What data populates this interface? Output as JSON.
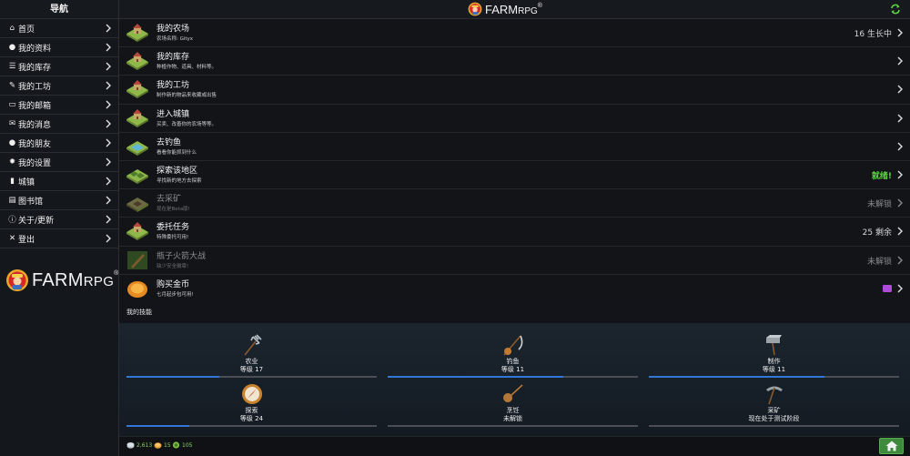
{
  "sidebar": {
    "title": "导航",
    "items": [
      {
        "label": "首页",
        "icon": "home-icon"
      },
      {
        "label": "我的资料",
        "icon": "user-icon"
      },
      {
        "label": "我的库存",
        "icon": "list-icon"
      },
      {
        "label": "我的工坊",
        "icon": "wrench-icon"
      },
      {
        "label": "我的邮箱",
        "icon": "inbox-icon"
      },
      {
        "label": "我的消息",
        "icon": "envelope-icon"
      },
      {
        "label": "我的朋友",
        "icon": "users-icon"
      },
      {
        "label": "我的设置",
        "icon": "gear-icon"
      },
      {
        "label": "城镇",
        "icon": "building-icon"
      },
      {
        "label": "图书馆",
        "icon": "book-icon"
      },
      {
        "label": "关于/更新",
        "icon": "info-icon"
      },
      {
        "label": "登出",
        "icon": "close-icon"
      }
    ],
    "logo": {
      "farm": "FARM",
      "rpg": "RPG",
      "tm": "®"
    }
  },
  "topbar": {
    "farm": "FARM",
    "rpg": "RPG",
    "tm": "®"
  },
  "menu": [
    {
      "title": "我的农场",
      "sub": "农场名称: Gityx",
      "right": "16 生长中",
      "state": "normal",
      "icon": "farm-icon"
    },
    {
      "title": "我的库存",
      "sub": "种植作物、道具、材料等。",
      "right": "",
      "state": "normal",
      "icon": "inventory-icon"
    },
    {
      "title": "我的工坊",
      "sub": "制作新的物品来收藏或出售",
      "right": "",
      "state": "normal",
      "icon": "workshop-icon"
    },
    {
      "title": "进入城镇",
      "sub": "买卖、改善你的农场等等。",
      "right": "",
      "state": "normal",
      "icon": "town-icon"
    },
    {
      "title": "去钓鱼",
      "sub": "看看你能抓到什么",
      "right": "",
      "state": "normal",
      "icon": "fishing-icon"
    },
    {
      "title": "探索该地区",
      "sub": "寻找新的地方去探索",
      "right": "就绪!",
      "state": "ready",
      "icon": "explore-icon"
    },
    {
      "title": "去采矿",
      "sub": "现在是Beta版!",
      "right": "未解锁",
      "state": "locked",
      "icon": "mining-icon"
    },
    {
      "title": "委托任务",
      "sub": "特殊委托可用!",
      "right": "25 剩余",
      "state": "normal",
      "icon": "quest-icon"
    },
    {
      "title": "瓶子火箭大战",
      "sub": "缺少安全徽章!",
      "right": "未解锁",
      "state": "locked",
      "icon": "rocket-icon"
    },
    {
      "title": "购买金币",
      "sub": "七月起步包可用!",
      "right": "",
      "state": "normal",
      "icon": "gold-coin-icon"
    }
  ],
  "skills": {
    "heading": "我的技能",
    "items": [
      {
        "name": "农业",
        "level": "等级 17",
        "progress": 0.37,
        "icon": "pitchfork-icon"
      },
      {
        "name": "钓鱼",
        "level": "等级 11",
        "progress": 0.7,
        "icon": "fishing-rod-icon"
      },
      {
        "name": "制作",
        "level": "等级 11",
        "progress": 0.7,
        "icon": "hammer-icon"
      },
      {
        "name": "探索",
        "level": "等级 24",
        "progress": 0.25,
        "icon": "compass-icon"
      },
      {
        "name": "烹饪",
        "level": "未解锁",
        "progress": 0,
        "icon": "ladle-icon"
      },
      {
        "name": "采矿",
        "level": "现在处于测试阶段",
        "progress": 0,
        "icon": "pickaxe-icon"
      }
    ]
  },
  "footer": {
    "silver": "2,613",
    "gold": "15",
    "stamina": "105"
  },
  "colors": {
    "ready": "#5fd343",
    "progress": "#3178d6",
    "home_button": "#3e8a3c"
  }
}
